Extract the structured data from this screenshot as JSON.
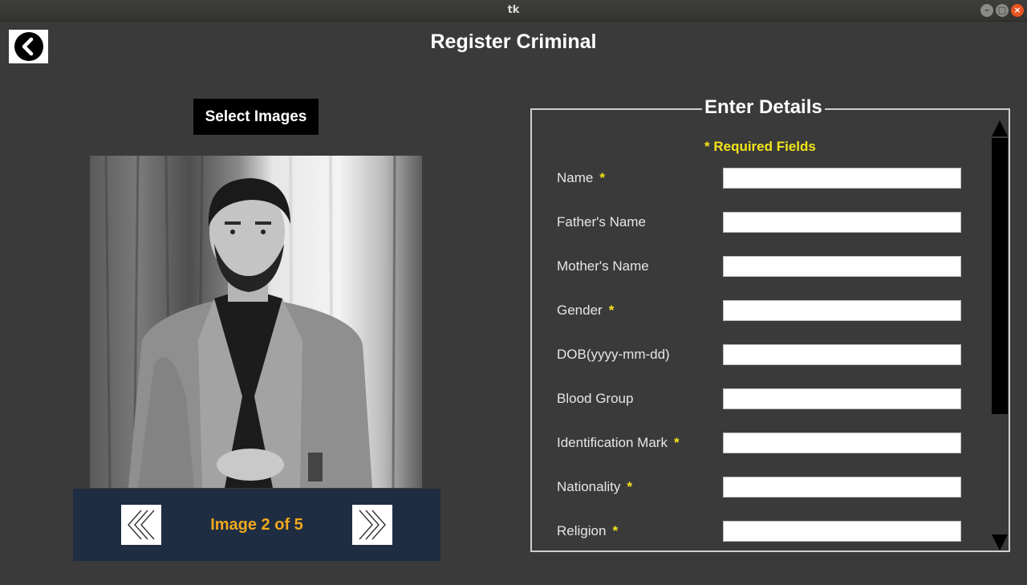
{
  "window": {
    "title": "tk"
  },
  "header": {
    "title": "Register Criminal"
  },
  "select_images_label": "Select Images",
  "image_nav": {
    "counter": "Image 2 of 5"
  },
  "details": {
    "legend": "Enter Details",
    "required_note": "* Required Fields",
    "required_star": "*",
    "fields": [
      {
        "label": "Name",
        "required": true,
        "value": ""
      },
      {
        "label": "Father's Name",
        "required": false,
        "value": ""
      },
      {
        "label": "Mother's Name",
        "required": false,
        "value": ""
      },
      {
        "label": "Gender",
        "required": true,
        "value": ""
      },
      {
        "label": "DOB(yyyy-mm-dd)",
        "required": false,
        "value": ""
      },
      {
        "label": "Blood Group",
        "required": false,
        "value": ""
      },
      {
        "label": "Identification Mark",
        "required": true,
        "value": ""
      },
      {
        "label": "Nationality",
        "required": true,
        "value": ""
      },
      {
        "label": "Religion",
        "required": true,
        "value": ""
      }
    ]
  },
  "colors": {
    "background": "#3a3a3a",
    "nav_panel": "#1f2d42",
    "counter_text": "#f0a81c",
    "required_text": "#f3e51a"
  },
  "icons": {
    "back": "chevron-left-icon",
    "prev": "double-chevron-left-icon",
    "next": "double-chevron-right-icon"
  }
}
